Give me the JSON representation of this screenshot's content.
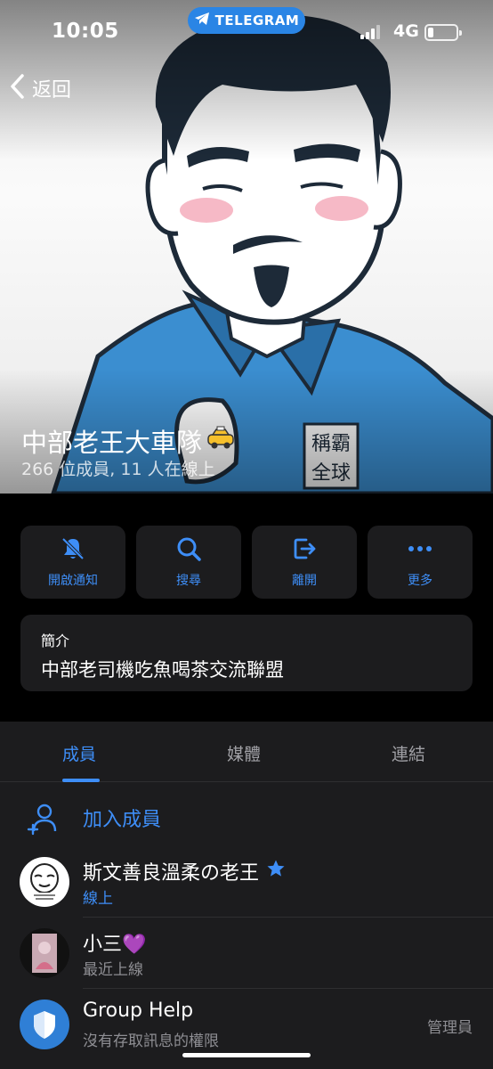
{
  "status_bar": {
    "time": "10:05",
    "app_pill": "TELEGRAM",
    "network": "4G",
    "accent": "#2a85e5"
  },
  "nav": {
    "back_label": "返回",
    "back_icon": "chevron-left-icon"
  },
  "group": {
    "name": "中部老王大車隊",
    "name_emoji": "taxi-icon",
    "subtitle": "266 位成員, 11 人在線上",
    "avatar_stamp_chars": [
      "稱",
      "霸",
      "全",
      "球"
    ]
  },
  "actions": [
    {
      "label": "開啟通知",
      "icon": "bell-slash-icon"
    },
    {
      "label": "搜尋",
      "icon": "search-icon"
    },
    {
      "label": "離開",
      "icon": "leave-icon"
    },
    {
      "label": "更多",
      "icon": "more-icon"
    }
  ],
  "about": {
    "heading": "簡介",
    "text": "中部老司機吃魚喝茶交流聯盟"
  },
  "tabs": [
    {
      "label": "成員",
      "active": true
    },
    {
      "label": "媒體",
      "active": false
    },
    {
      "label": "連結",
      "active": false
    }
  ],
  "add_member": {
    "label": "加入成員",
    "icon": "add-person-icon"
  },
  "members": [
    {
      "name": "斯文善良溫柔の老王",
      "badge": "star-icon",
      "status": "線上",
      "online": true,
      "role": ""
    },
    {
      "name": "小三💜",
      "badge": "",
      "status": "最近上線",
      "online": false,
      "role": ""
    },
    {
      "name": "Group Help",
      "badge": "",
      "status": "沒有存取訊息的權限",
      "online": false,
      "role": "管理員"
    }
  ],
  "colors": {
    "accent_blue": "#3e8ef7",
    "card_bg": "#1c1c1e",
    "secondary_text": "#8e8e93"
  }
}
